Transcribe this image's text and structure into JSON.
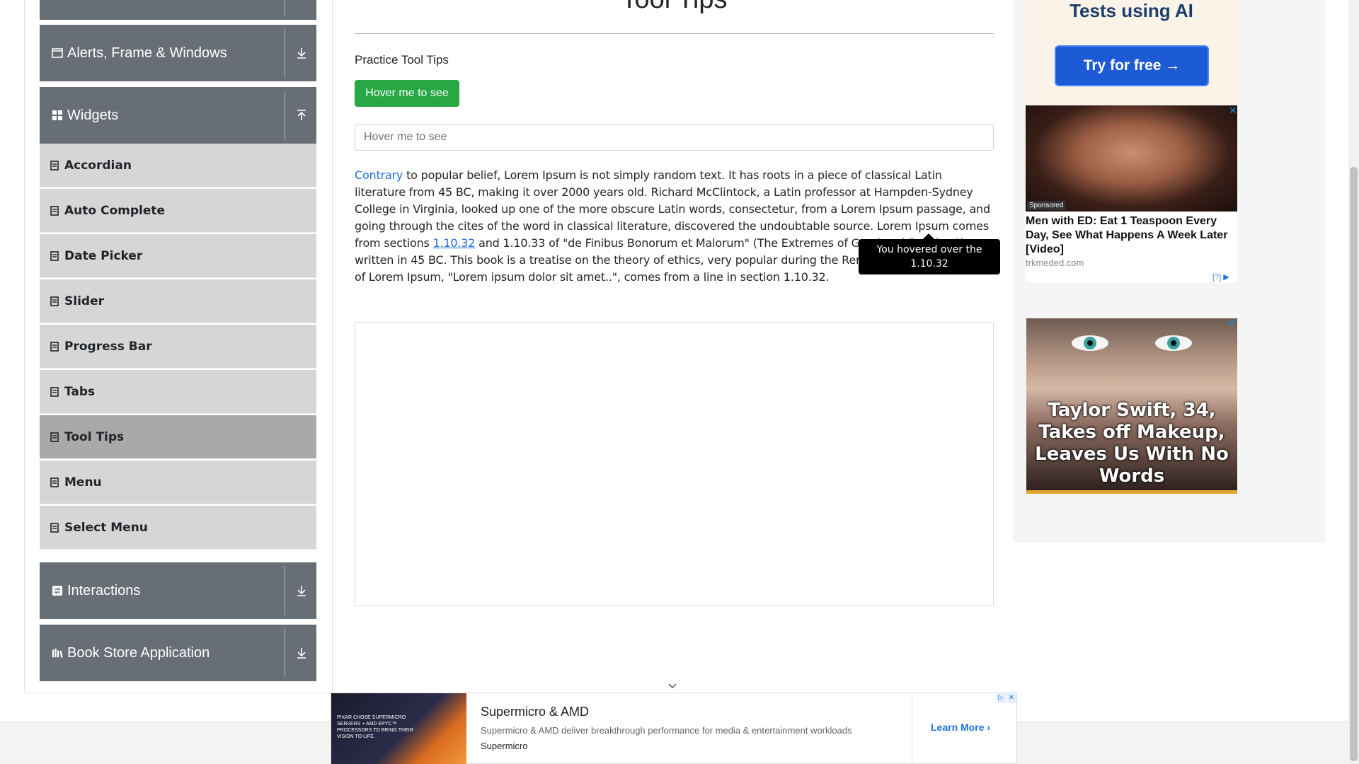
{
  "sidebar": {
    "groups": {
      "alerts": {
        "title": "Alerts, Frame & Windows",
        "icon": "window-icon",
        "toggle_icon": "download-arrow-icon"
      },
      "widgets": {
        "title": "Widgets",
        "icon": "widgets-grid-icon",
        "toggle_icon": "upload-arrow-icon"
      },
      "interactions": {
        "title": "Interactions",
        "icon": "interactions-icon",
        "toggle_icon": "download-arrow-icon"
      },
      "bookstore": {
        "title": "Book Store Application",
        "icon": "books-icon",
        "toggle_icon": "download-arrow-icon"
      }
    },
    "widget_items": [
      {
        "label": "Accordian"
      },
      {
        "label": "Auto Complete"
      },
      {
        "label": "Date Picker"
      },
      {
        "label": "Slider"
      },
      {
        "label": "Progress Bar"
      },
      {
        "label": "Tabs"
      },
      {
        "label": "Tool Tips",
        "active": true
      },
      {
        "label": "Menu"
      },
      {
        "label": "Select Menu"
      }
    ]
  },
  "main": {
    "page_title": "Tool Tips",
    "practice_label": "Practice Tool Tips",
    "hover_button_label": "Hover me to see",
    "hover_input_placeholder": "Hover me to see",
    "paragraph": {
      "link_contrary": "Contrary",
      "text_1": " to popular belief, Lorem Ipsum is not simply random text. It has roots in a piece of classical Latin literature from 45 BC, making it over 2000 years old. Richard McClintock, a Latin professor at Hampden-Sydney College in Virginia, looked up one of the more obscure Latin words, consectetur, from a Lorem Ipsum passage, and going through the cites of the word in classical literature, discovered the undoubtable source. Lorem Ipsum comes from sections ",
      "link_section": "1.10.32",
      "text_2": " and 1.10.33 of \"de Finibus Bonorum et Malorum\" (The Extremes of Good and Evil) by Cicero, written in 45 BC. This book is a treatise on the theory of ethics, very popular during the Renaissance. The first line of Lorem Ipsum, \"Lorem ipsum dolor sit amet..\", comes from a line in section 1.10.32."
    },
    "tooltip_text": "You hovered over the 1.10.32"
  },
  "ads": {
    "top_ad_text": "Tests using AI",
    "top_ad_button": "Try for free →",
    "ed_ad": {
      "sponsored": "Sponsored",
      "headline": "Men with ED: Eat 1 Teaspoon Every Day, See What Happens A Week Later [Video]",
      "domain": "trkmeded.com",
      "adchoice": "[?]",
      "close": "✕"
    },
    "taylor_ad": {
      "headline": "Taylor Swift, 34, Takes off Makeup, Leaves Us With No Words",
      "close": "✕"
    },
    "banner": {
      "title": "Supermicro & AMD",
      "description": "Supermicro & AMD deliver breakthrough performance for media & entertainment workloads",
      "brand": "Supermicro",
      "cta": "Learn More",
      "image_caption": "PIXAR CHOSE SUPERMICRO SERVERS + AMD EPYC™ PROCESSORS TO BRING THEIR VISION TO LIFE."
    }
  },
  "colors": {
    "sidebar_header": "#676e75",
    "sidebar_item": "#d6d6d6",
    "sidebar_item_active": "#a9a9a9",
    "button_green": "#28a745",
    "link_blue": "#1e6fd9",
    "tooltip_bg": "#000000"
  }
}
